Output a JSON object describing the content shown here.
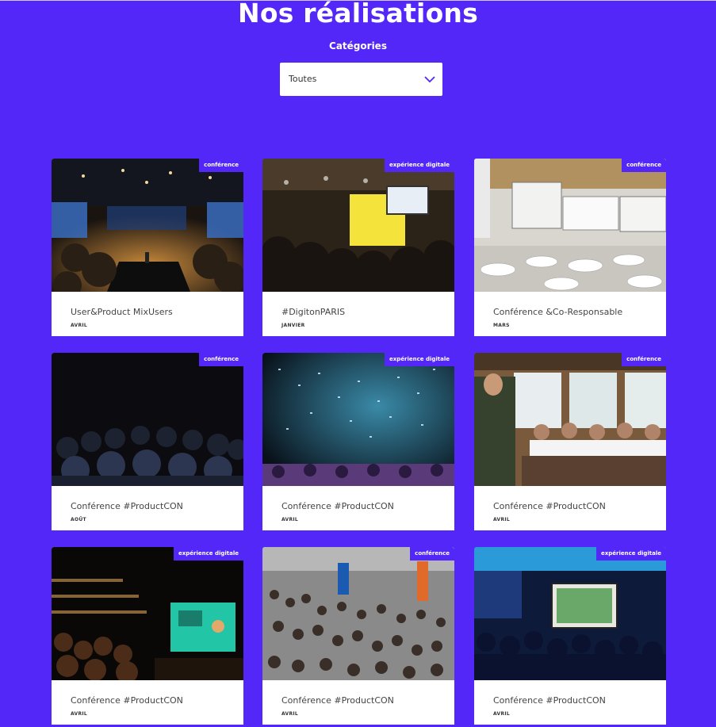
{
  "header": {
    "title": "Nos réalisations",
    "filter_label": "Catégories",
    "filter_value": "Toutes"
  },
  "colors": {
    "background": "#5227f7",
    "badge": "#5227f7",
    "card": "#ffffff"
  },
  "cards": [
    {
      "badge": "conférence",
      "title": "User&Product MixUsers",
      "month": "AVRIL",
      "photo": "conference-hall-stage"
    },
    {
      "badge": "expérience digitale",
      "title": "#DigitonPARIS",
      "month": "JANVIER",
      "photo": "audience-yellow-screen"
    },
    {
      "badge": "conférence",
      "title": "Conférence &Co-Responsable",
      "month": "MARS",
      "photo": "banquet-room-screens"
    },
    {
      "badge": "conférence",
      "title": "Conférence #ProductCON",
      "month": "AOÛT",
      "photo": "dark-audience"
    },
    {
      "badge": "expérience digitale",
      "title": "Conférence #ProductCON",
      "month": "AVRIL",
      "photo": "confetti-concert"
    },
    {
      "badge": "conférence",
      "title": "Conférence #ProductCON",
      "month": "AVRIL",
      "photo": "speaker-dinner-tables"
    },
    {
      "badge": "expérience digitale",
      "title": "Conférence #ProductCON",
      "month": "AVRIL",
      "photo": "theatre-stage-screen"
    },
    {
      "badge": "conférence",
      "title": "Conférence #ProductCON",
      "month": "AVRIL",
      "photo": "crowd-from-above"
    },
    {
      "badge": "expérience digitale",
      "title": "Conférence #ProductCON",
      "month": "AVRIL",
      "photo": "blue-room-projection"
    }
  ]
}
